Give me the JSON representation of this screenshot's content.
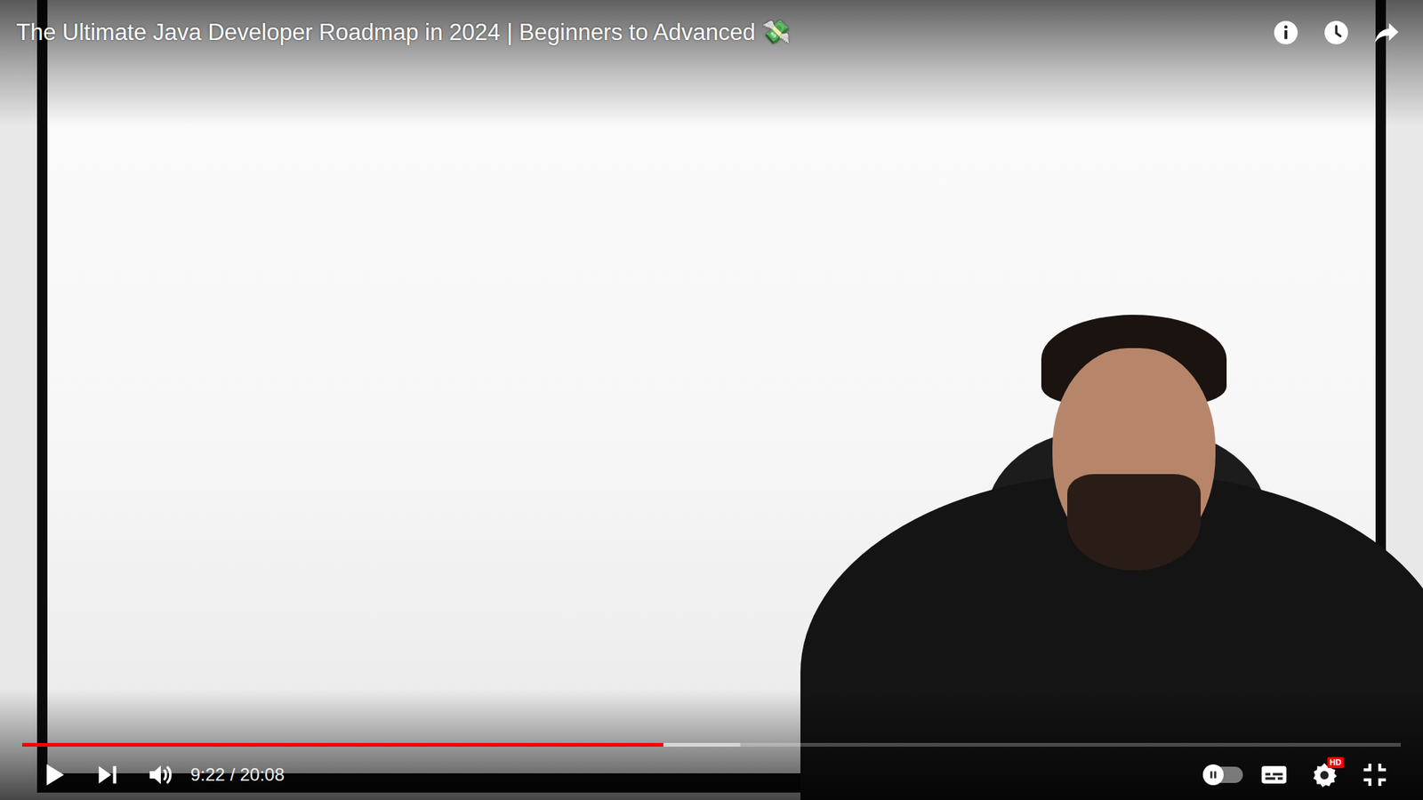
{
  "player": {
    "title": "The Ultimate Java Developer Roadmap in 2024 | Beginners to Advanced 💸",
    "playing": false,
    "muted": false,
    "autoplay_on": false,
    "captions_on": false
  },
  "progress": {
    "level": 0.465,
    "buffered": 0.521
  },
  "time": "9:22 / 20:08",
  "quality_badge": "HD"
}
